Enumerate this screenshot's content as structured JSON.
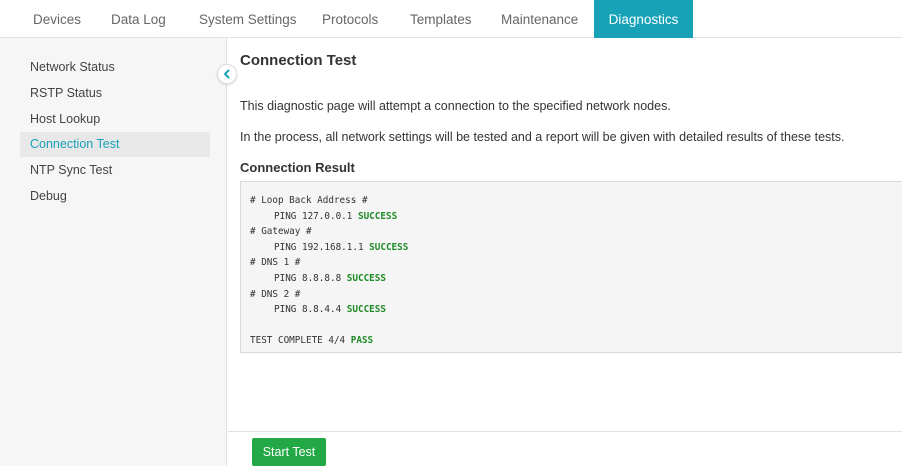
{
  "topnav": {
    "tabs": [
      {
        "label": "Devices"
      },
      {
        "label": "Data Log"
      },
      {
        "label": "System Settings"
      },
      {
        "label": "Protocols"
      },
      {
        "label": "Templates"
      },
      {
        "label": "Maintenance"
      },
      {
        "label": "Diagnostics",
        "active": true
      }
    ]
  },
  "sidebar": {
    "items": [
      {
        "label": "Network Status"
      },
      {
        "label": "RSTP Status"
      },
      {
        "label": "Host Lookup"
      },
      {
        "label": "Connection Test",
        "active": true
      },
      {
        "label": "NTP Sync Test"
      },
      {
        "label": "Debug"
      }
    ],
    "collapse_icon": "chevron-left-icon"
  },
  "main": {
    "title": "Connection Test",
    "description_1": "This diagnostic page will attempt a connection to the specified network nodes.",
    "description_2": "In the process, all network settings will be tested and a report will be given with detailed results of these tests.",
    "result_label": "Connection Result",
    "result": {
      "sections": [
        {
          "header": "# Loop Back Address #",
          "ping": "PING 127.0.0.1",
          "status": "SUCCESS"
        },
        {
          "header": "# Gateway #",
          "ping": "PING 192.168.1.1",
          "status": "SUCCESS"
        },
        {
          "header": "# DNS 1 #",
          "ping": "PING 8.8.8.8",
          "status": "SUCCESS"
        },
        {
          "header": "# DNS 2 #",
          "ping": "PING 8.8.4.4",
          "status": "SUCCESS"
        }
      ],
      "summary": "TEST COMPLETE 4/4",
      "summary_status": "PASS"
    }
  },
  "footer": {
    "start_button": "Start Test"
  },
  "colors": {
    "accent": "#17a2b8",
    "success_text": "#1e8a26",
    "button_green": "#22a845"
  }
}
